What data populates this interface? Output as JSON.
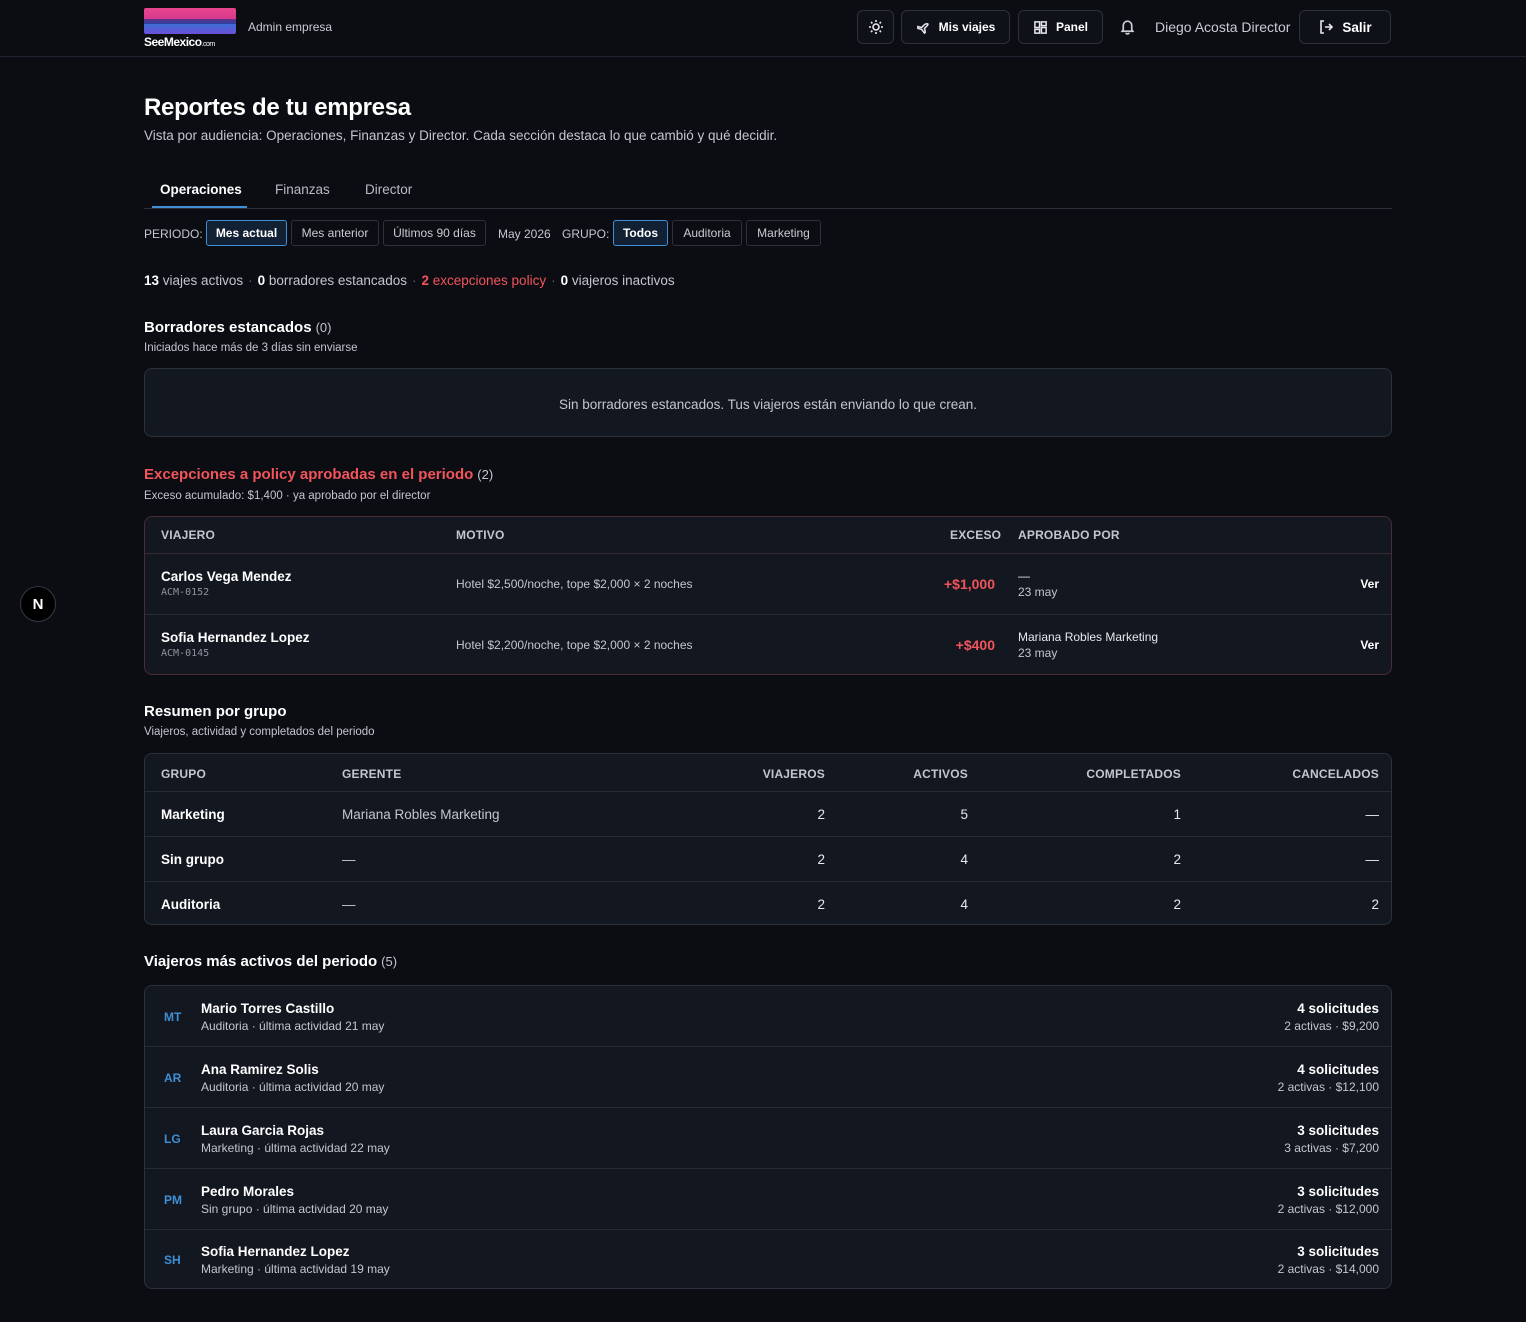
{
  "header": {
    "logo_text": "SeeMexico",
    "logo_suffix": ".com",
    "role_label": "Admin empresa",
    "theme_icon": "sun-icon",
    "mis_viajes_label": "Mis viajes",
    "panel_label": "Panel",
    "user_name": "Diego Acosta Director",
    "logout_label": "Salir"
  },
  "page": {
    "title": "Reportes de tu empresa",
    "subtitle": "Vista por audiencia: Operaciones, Finanzas y Director. Cada sección destaca lo que cambió y qué decidir."
  },
  "tabs": [
    {
      "label": "Operaciones",
      "active": true
    },
    {
      "label": "Finanzas",
      "active": false
    },
    {
      "label": "Director",
      "active": false
    }
  ],
  "filters": {
    "period_label": "PERIODO:",
    "periods": [
      "Mes actual",
      "Mes anterior",
      "Últimos 90 días"
    ],
    "period_active": "Mes actual",
    "period_value": "May 2026",
    "group_label": "GRUPO:",
    "groups": [
      "Todos",
      "Auditoria",
      "Marketing"
    ],
    "group_active": "Todos"
  },
  "summary": {
    "active_trips_n": "13",
    "active_trips_label": "viajes activos",
    "stale_drafts_n": "0",
    "stale_drafts_label": "borradores estancados",
    "policy_exceptions_n": "2",
    "policy_exceptions_label": "excepciones policy",
    "inactive_travelers_n": "0",
    "inactive_travelers_label": "viajeros inactivos",
    "separator": "·"
  },
  "drafts": {
    "title": "Borradores estancados",
    "count": "(0)",
    "subtitle": "Iniciados hace más de 3 días sin enviarse",
    "empty_message": "Sin borradores estancados. Tus viajeros están enviando lo que crean."
  },
  "exceptions": {
    "title": "Excepciones a policy aprobadas en el periodo",
    "count": "(2)",
    "subtitle": "Exceso acumulado: $1,400 · ya aprobado por el director",
    "columns": {
      "traveler": "VIAJERO",
      "reason": "MOTIVO",
      "excess": "EXCESO",
      "approved_by": "APROBADO POR"
    },
    "rows": [
      {
        "name": "Carlos Vega Mendez",
        "code": "ACM-0152",
        "reason": "Hotel $2,500/noche, tope $2,000 × 2 noches",
        "excess": "+$1,000",
        "approver": "—",
        "date": "23 may",
        "action": "Ver"
      },
      {
        "name": "Sofia Hernandez Lopez",
        "code": "ACM-0145",
        "reason": "Hotel $2,200/noche, tope $2,000 × 2 noches",
        "excess": "+$400",
        "approver": "Mariana Robles Marketing",
        "date": "23 may",
        "action": "Ver"
      }
    ]
  },
  "groups_summary": {
    "title": "Resumen por grupo",
    "subtitle": "Viajeros, actividad y completados del periodo",
    "columns": {
      "group": "GRUPO",
      "manager": "GERENTE",
      "travelers": "VIAJEROS",
      "active": "ACTIVOS",
      "completed": "COMPLETADOS",
      "cancelled": "CANCELADOS"
    },
    "rows": [
      {
        "group": "Marketing",
        "manager": "Mariana Robles Marketing",
        "travelers": "2",
        "active": "5",
        "completed": "1",
        "cancelled": "—"
      },
      {
        "group": "Sin grupo",
        "manager": "—",
        "travelers": "2",
        "active": "4",
        "completed": "2",
        "cancelled": "—"
      },
      {
        "group": "Auditoria",
        "manager": "—",
        "travelers": "2",
        "active": "4",
        "completed": "2",
        "cancelled": "2"
      }
    ]
  },
  "top_travelers": {
    "title": "Viajeros más activos del periodo",
    "count": "(5)",
    "rows": [
      {
        "initials": "MT",
        "name": "Mario Torres Castillo",
        "meta": "Auditoria · última actividad 21 may",
        "requests": "4 solicitudes",
        "detail": "2 activas · $9,200"
      },
      {
        "initials": "AR",
        "name": "Ana Ramirez Solis",
        "meta": "Auditoria · última actividad 20 may",
        "requests": "4 solicitudes",
        "detail": "2 activas · $12,100"
      },
      {
        "initials": "LG",
        "name": "Laura Garcia Rojas",
        "meta": "Marketing · última actividad 22 may",
        "requests": "3 solicitudes",
        "detail": "3 activas · $7,200"
      },
      {
        "initials": "PM",
        "name": "Pedro Morales",
        "meta": "Sin grupo · última actividad 20 may",
        "requests": "3 solicitudes",
        "detail": "2 activas · $12,000"
      },
      {
        "initials": "SH",
        "name": "Sofia Hernandez Lopez",
        "meta": "Marketing · última actividad 19 may",
        "requests": "3 solicitudes",
        "detail": "2 activas · $14,000"
      }
    ]
  },
  "dev_badge": "N",
  "colors": {
    "accent": "#3e8fd6",
    "danger": "#f2545b",
    "success": "#2bb3a3",
    "background": "#0b0d12",
    "card": "#131720"
  }
}
